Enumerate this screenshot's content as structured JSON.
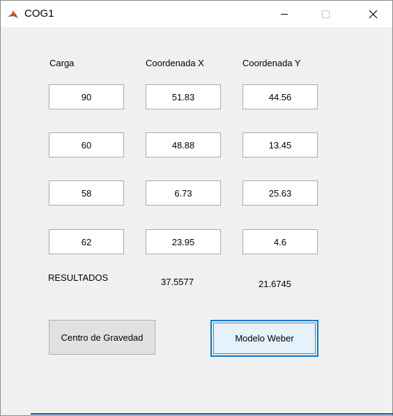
{
  "window": {
    "title": "COG1",
    "icon": "matlab-icon",
    "controls": [
      "minimize-icon",
      "maximize-icon",
      "close-icon"
    ]
  },
  "headers": {
    "carga": "Carga",
    "coord_x": "Coordenada X",
    "coord_y": "Coordenada Y"
  },
  "rows": [
    {
      "carga": "90",
      "x": "51.83",
      "y": "44.56"
    },
    {
      "carga": "60",
      "x": "48.88",
      "y": "13.45"
    },
    {
      "carga": "58",
      "x": "6.73",
      "y": "25.63"
    },
    {
      "carga": "62",
      "x": "23.95",
      "y": "4.6"
    }
  ],
  "results": {
    "label": "RESULTADOS",
    "x": "37.5577",
    "y": "21.6745"
  },
  "buttons": {
    "centro_gravedad": "Centro de Gravedad",
    "modelo_weber": "Modelo Weber"
  },
  "colors": {
    "focus_accent": "#0078d7",
    "focus_fill": "#e5f1fb",
    "window_bg": "#f0f0f0"
  }
}
